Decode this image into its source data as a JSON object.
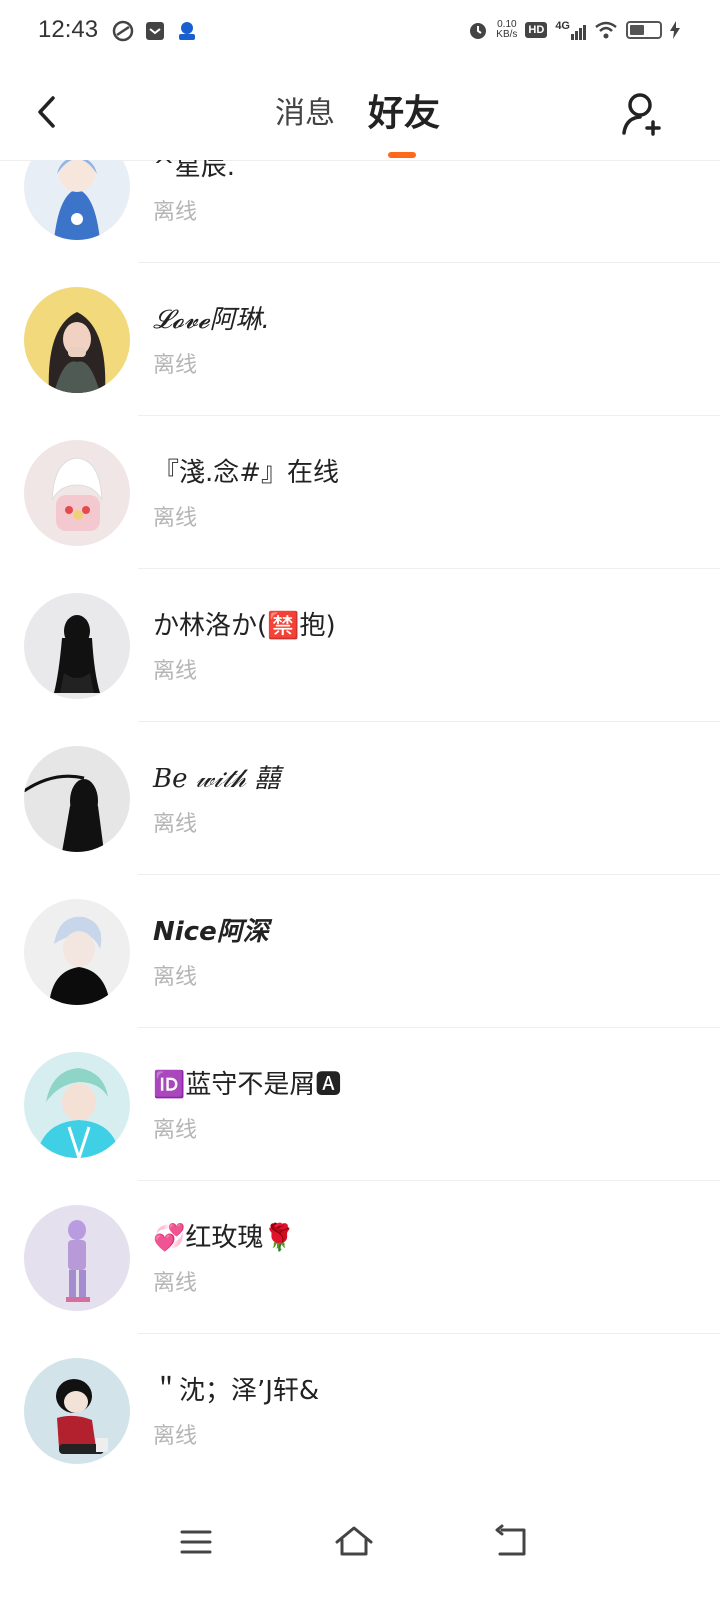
{
  "status_bar": {
    "time": "12:43",
    "speed_value": "0.10",
    "speed_unit": "KB/s",
    "hd": "HD",
    "network": "4G"
  },
  "header": {
    "tab_messages": "消息",
    "tab_friends": "好友",
    "active_tab": "好友",
    "accent_color": "#ff6a1a"
  },
  "friends": [
    {
      "name": "^星辰.",
      "status": "离线"
    },
    {
      "name": "𝓛𝓸𝓿𝓮阿琳.",
      "status": "离线"
    },
    {
      "name": "『淺.念#』在线",
      "status": "离线"
    },
    {
      "name": "か林洛か(🈲抱)",
      "status": "离线"
    },
    {
      "name": "𝐵𝑒  𝓌𝒾𝓉𝒽 囍",
      "status": "离线"
    },
    {
      "name": "𝙉𝙞𝙘𝙚阿深",
      "status": "离线"
    },
    {
      "name": "🆔蓝守不是屑🅰",
      "status": "离线"
    },
    {
      "name": "💞红玫瑰🌹",
      "status": "离线"
    },
    {
      "name": "＂沈；泽’J轩&",
      "status": "离线"
    }
  ],
  "icons": {
    "back": "back-arrow-icon",
    "add_friend": "add-friend-icon",
    "menu": "menu-icon",
    "home": "home-icon",
    "back_nav": "back-nav-icon"
  }
}
